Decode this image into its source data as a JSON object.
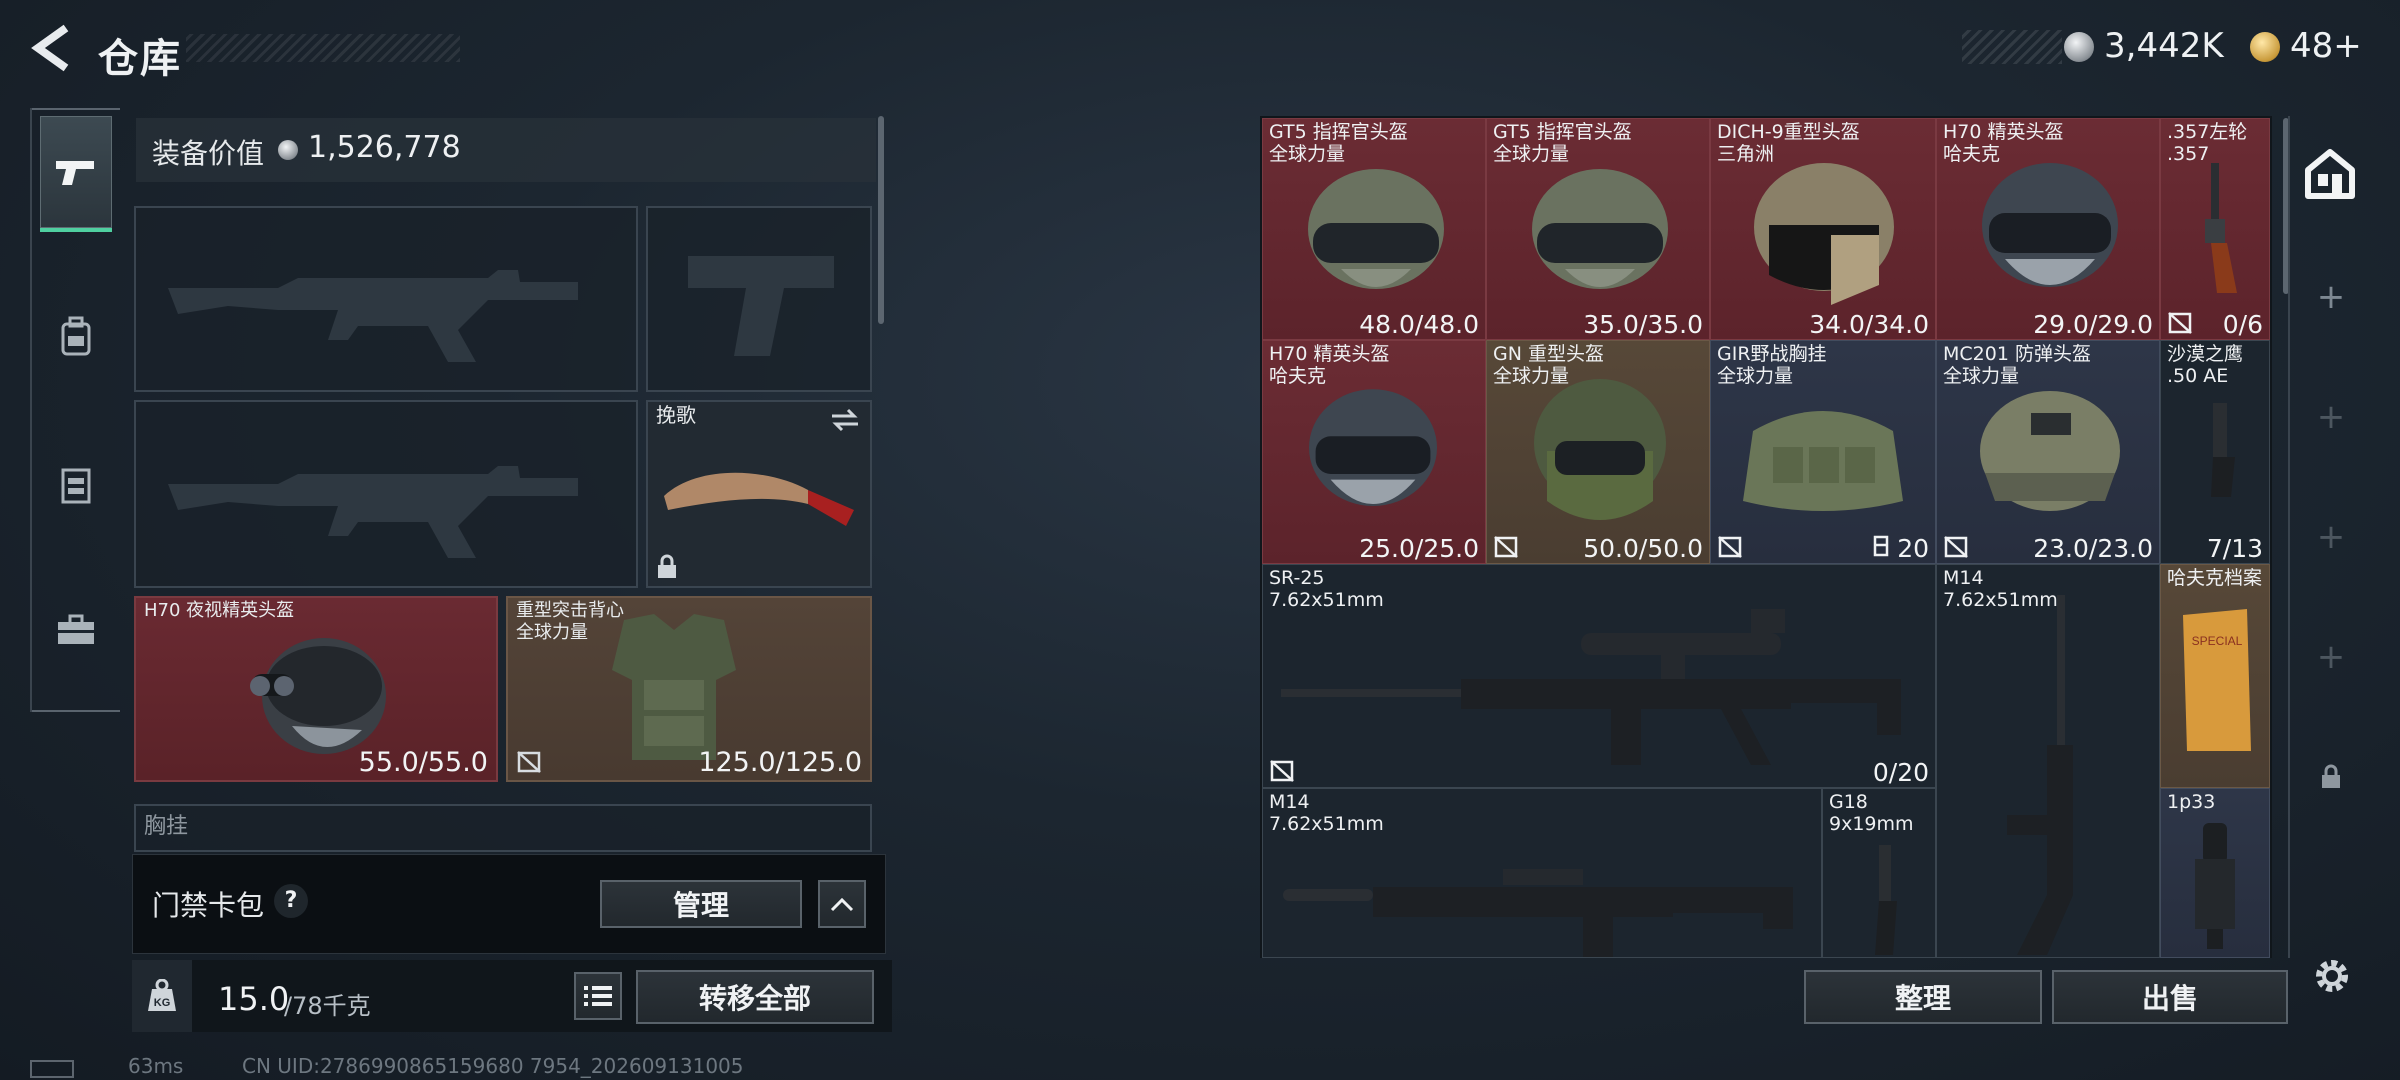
{
  "header": {
    "title": "仓库",
    "currency_silver": "3,442K",
    "currency_gold": "48+"
  },
  "nav": {
    "items": [
      "weapons",
      "backpack",
      "rig",
      "case"
    ]
  },
  "equipment": {
    "value_label": "装备价值",
    "value": "1,526,778",
    "melee_label": "挽歌",
    "helmet": {
      "name": "H70 夜视精英头盔",
      "durability": "55.0/55.0"
    },
    "armor": {
      "name": "重型突击背心\n全球力量",
      "durability": "125.0/125.0"
    },
    "chest_rig_label": "胸挂"
  },
  "keycard": {
    "label": "门禁卡包",
    "help": "?",
    "manage_button": "管理"
  },
  "bottom": {
    "weight": "15.0",
    "weight_max": "/78千克",
    "transfer_button": "转移全部"
  },
  "storage": {
    "items": [
      {
        "name": "GT5 指挥官头盔\n全球力量",
        "value": "48.0/48.0"
      },
      {
        "name": "GT5 指挥官头盔\n全球力量",
        "value": "35.0/35.0"
      },
      {
        "name": "DICH-9重型头盔\n三角洲",
        "value": "34.0/34.0"
      },
      {
        "name": "H70 精英头盔\n哈夫克",
        "value": "29.0/29.0"
      },
      {
        "name": ".357左轮\n.357",
        "value": "0/6"
      },
      {
        "name": "H70 精英头盔\n哈夫克",
        "value": "25.0/25.0"
      },
      {
        "name": "GN 重型头盔\n全球力量",
        "value": "50.0/50.0"
      },
      {
        "name": "GIR野战胸挂\n全球力量",
        "value": "20"
      },
      {
        "name": "MC201 防弹头盔\n全球力量",
        "value": "23.0/23.0"
      },
      {
        "name": "沙漠之鹰\n.50 AE",
        "value": "7/13"
      },
      {
        "name": "SR-25\n7.62x51mm",
        "value": "0/20"
      },
      {
        "name": "M14\n7.62x51mm",
        "value": ""
      },
      {
        "name": "哈夫克档案",
        "value": ""
      },
      {
        "name": "M14\n7.62x51mm",
        "value": ""
      },
      {
        "name": "G18\n9x19mm",
        "value": ""
      },
      {
        "name": "1p33",
        "value": ""
      }
    ],
    "sort_button": "整理",
    "sell_button": "出售"
  },
  "status": {
    "ping": "63ms",
    "uid": "CN UID:2786990865159680 7954_202609131005"
  },
  "colors": {
    "accent": "#4fd0a0",
    "item_red": "#6b2c34",
    "item_blue": "#2e3648",
    "item_brown": "#574838"
  }
}
